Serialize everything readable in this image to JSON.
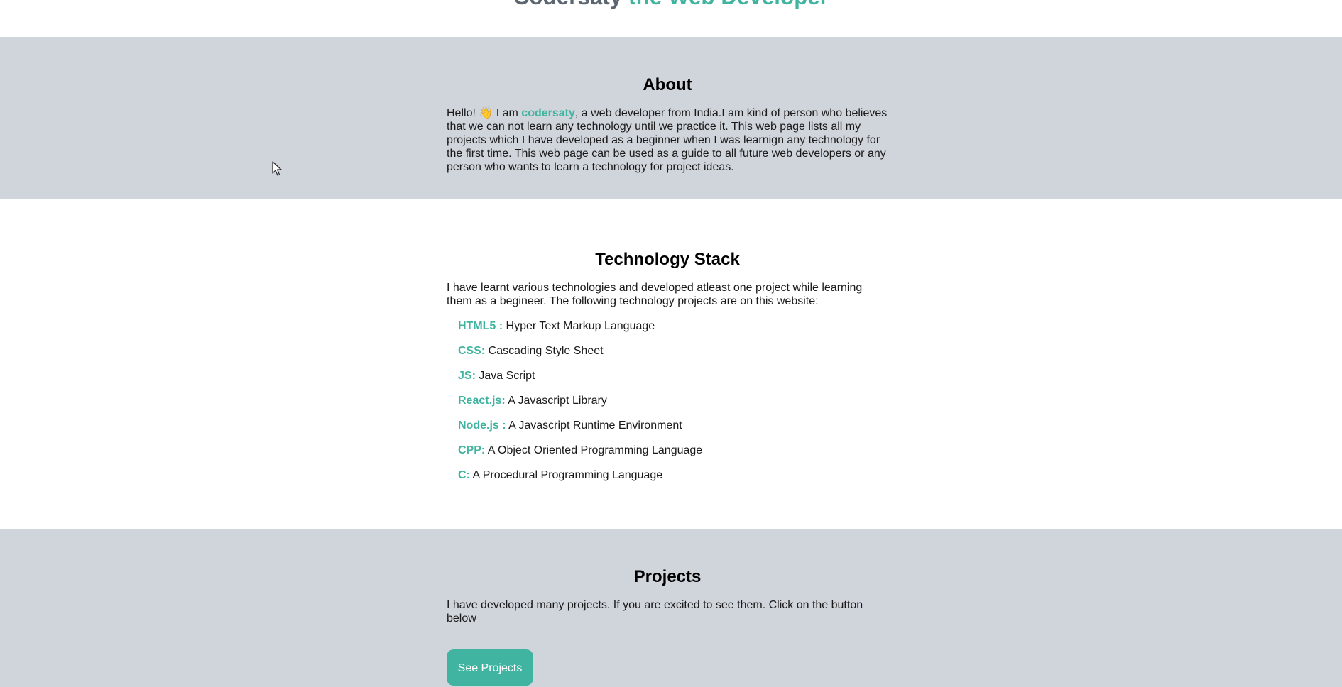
{
  "hero": {
    "name": "Codersaty",
    "accent": "the Web Developer"
  },
  "about": {
    "heading": "About",
    "intro_before": "Hello!",
    "wave_icon": "👋",
    "intro_mid": " I am ",
    "name": "codersaty",
    "intro_after": ", a web developer from India.I am kind of person who believes that we can not learn any technology until we practice it. This web page lists all my projects which I have developed as a beginner when I was learnign any technology for the first time. This web page can be used as a guide to all future web developers or any person who wants to learn a technology for project ideas."
  },
  "tech": {
    "heading": "Technology Stack",
    "intro": "I have learnt various technologies and developed atleast one project while learning them as a begineer. The following technology projects are on this website:",
    "items": [
      {
        "term": "HTML5 :",
        "desc": " Hyper Text Markup Language"
      },
      {
        "term": "CSS:",
        "desc": " Cascading Style Sheet"
      },
      {
        "term": "JS:",
        "desc": " Java Script"
      },
      {
        "term": "React.js:",
        "desc": " A Javascript Library"
      },
      {
        "term": "Node.js :",
        "desc": " A Javascript Runtime Environment"
      },
      {
        "term": "CPP:",
        "desc": " A Object Oriented Programming Language"
      },
      {
        "term": "C:",
        "desc": " A Procedural Programming Language"
      }
    ]
  },
  "projects": {
    "heading": "Projects",
    "intro": "I have developed many projects. If you are excited to see them. Click on the button below",
    "button_label": "See Projects"
  },
  "colors": {
    "accent": "#40b4a0",
    "section_gray": "#d0d4db",
    "hero_name": "#5c6670"
  }
}
